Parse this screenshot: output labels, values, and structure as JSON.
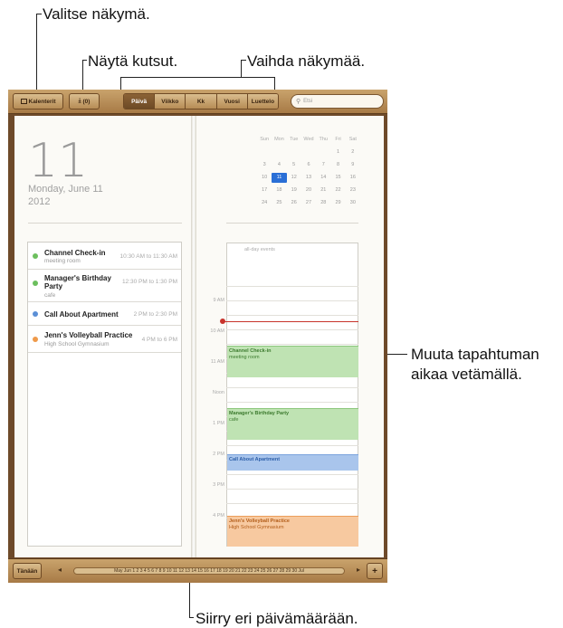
{
  "callouts": {
    "select_view": "Valitse näkymä.",
    "show_invites": "Näytä kutsut.",
    "switch_view": "Vaihda näkymää.",
    "drag_event": "Muuta tapahtuman",
    "drag_event2": "aikaa vetämällä.",
    "go_to_date": "Siirry eri päivämäärään."
  },
  "toolbar": {
    "calendars_label": "Kalenterit",
    "invites_label": "(0)",
    "tabs": [
      "Päivä",
      "Viikko",
      "Kk",
      "Vuosi",
      "Luettelo"
    ],
    "active_tab": "Päivä",
    "search_placeholder": "Etsi"
  },
  "day": {
    "number": "11",
    "weekday_date": "Monday, June 11",
    "year": "2012"
  },
  "events": [
    {
      "title": "Channel Check-in",
      "sub": "meeting room",
      "time": "10:30 AM to 11:30 AM",
      "color": "#6cbf5e"
    },
    {
      "title": "Manager's Birthday Party",
      "sub": "cafe",
      "time": "12:30 PM to 1:30 PM",
      "color": "#6cbf5e"
    },
    {
      "title": "Call About Apartment",
      "sub": "",
      "time": "2 PM to 2:30 PM",
      "color": "#5b8fd6"
    },
    {
      "title": "Jenn's Volleyball Practice",
      "sub": "High School Gymnasium",
      "time": "4 PM to 6 PM",
      "color": "#ef9a4a"
    }
  ],
  "mini_calendar": {
    "headers": [
      "Sun",
      "Mon",
      "Tue",
      "Wed",
      "Thu",
      "Fri",
      "Sat"
    ],
    "weeks": [
      [
        "",
        "",
        "",
        "",
        "",
        "1",
        "2"
      ],
      [
        "3",
        "4",
        "5",
        "6",
        "7",
        "8",
        "9"
      ],
      [
        "10",
        "11",
        "12",
        "13",
        "14",
        "15",
        "16"
      ],
      [
        "17",
        "18",
        "19",
        "20",
        "21",
        "22",
        "23"
      ],
      [
        "24",
        "25",
        "26",
        "27",
        "28",
        "29",
        "30"
      ]
    ],
    "selected": "11"
  },
  "day_view": {
    "all_day": "all-day events",
    "hours": [
      "9 AM",
      "10 AM",
      "11 AM",
      "Noon",
      "1 PM",
      "2 PM",
      "3 PM",
      "4 PM"
    ],
    "blocks": [
      {
        "title": "Channel Check-in",
        "sub": "meeting room",
        "bg": "#bfe3b3",
        "fg": "#3c7a2e",
        "border": "#8cc77c"
      },
      {
        "title": "Manager's Birthday Party",
        "sub": "cafe",
        "bg": "#bfe3b3",
        "fg": "#3c7a2e",
        "border": "#8cc77c"
      },
      {
        "title": "Call About Apartment",
        "sub": "",
        "bg": "#a9c5ec",
        "fg": "#2c5ea8",
        "border": "#7aa3dd"
      },
      {
        "title": "Jenn's Volleyball Practice",
        "sub": "High School Gymnasium",
        "bg": "#f7c9a0",
        "fg": "#b25c18",
        "border": "#ec9e5c"
      }
    ]
  },
  "bottom": {
    "today_label": "Tänään",
    "strip_text": "May  Jun 1 2 3 4 5 6 7 8 9 10 11 12 13 14 15 16 17 18 19 20 21 22 23 24 25 26 27 28 29 30  Jul",
    "add_label": "+"
  }
}
